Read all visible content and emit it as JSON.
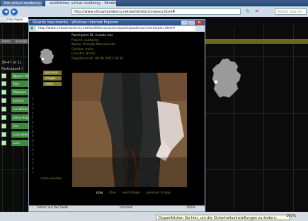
{
  "background_browser": {
    "tab1": "the virtual residency: sh...",
    "tab2": "exhibitions: virtual residency - Windows Internet Explorer",
    "address": "http://www.virtualresidency.net/exhibitions/unesco.html#",
    "search_placeholder": "Yahoo! Search",
    "address_small": "http://www.",
    "nav": {
      "home": "Home",
      "concept": "Konzept"
    },
    "results": "36-47 of 21",
    "participant": "Participant I",
    "list_buttons": [
      "Nguyen Hai",
      "Rtas",
      "Wakpaba",
      "Kamran",
      "Lee Wilkens",
      "Leena Huga",
      "Lina",
      "Luiza Seme",
      "Lumi"
    ],
    "status_tip": "Doppelklicken Sie hier, um die Sicherheitseinstellungen zu ändern.",
    "zoom": "100%"
  },
  "popup": {
    "title": "Ricardo Nascimento - Windows Internet Explorer",
    "address": "http://www.virtualresidency.net/exhibitions/unesco/participant/nascimento/pics.html#",
    "info": {
      "id": "Participant ID: ricardo nas",
      "project": "Project: authority",
      "name": "Name: Ricardo Nascimento",
      "gender": "Gender: male",
      "country": "Country: Brazil",
      "registered": "Registered at: 06.08.2007 18:30"
    },
    "buttons": [
      "personal",
      "images",
      "video"
    ],
    "digits": [
      "1",
      "2",
      "3",
      "4",
      "5",
      "6",
      "7",
      "8",
      "9",
      "0",
      "1",
      "2",
      "3",
      "4",
      "5",
      "6",
      "7",
      "8",
      "9"
    ],
    "close_link": "close window",
    "controls": {
      "play": "play",
      "stop": "stop",
      "next": "next image",
      "previous": "previous image"
    },
    "status_done": "Fertig",
    "status_text": "Fehler auf der Seite.",
    "status_internet": "Internet",
    "status_zoom": "100%"
  },
  "colors": {
    "accent_green": "#3f8a3f",
    "olive": "#7e7a2e",
    "title_blue": "#2a4f86"
  }
}
